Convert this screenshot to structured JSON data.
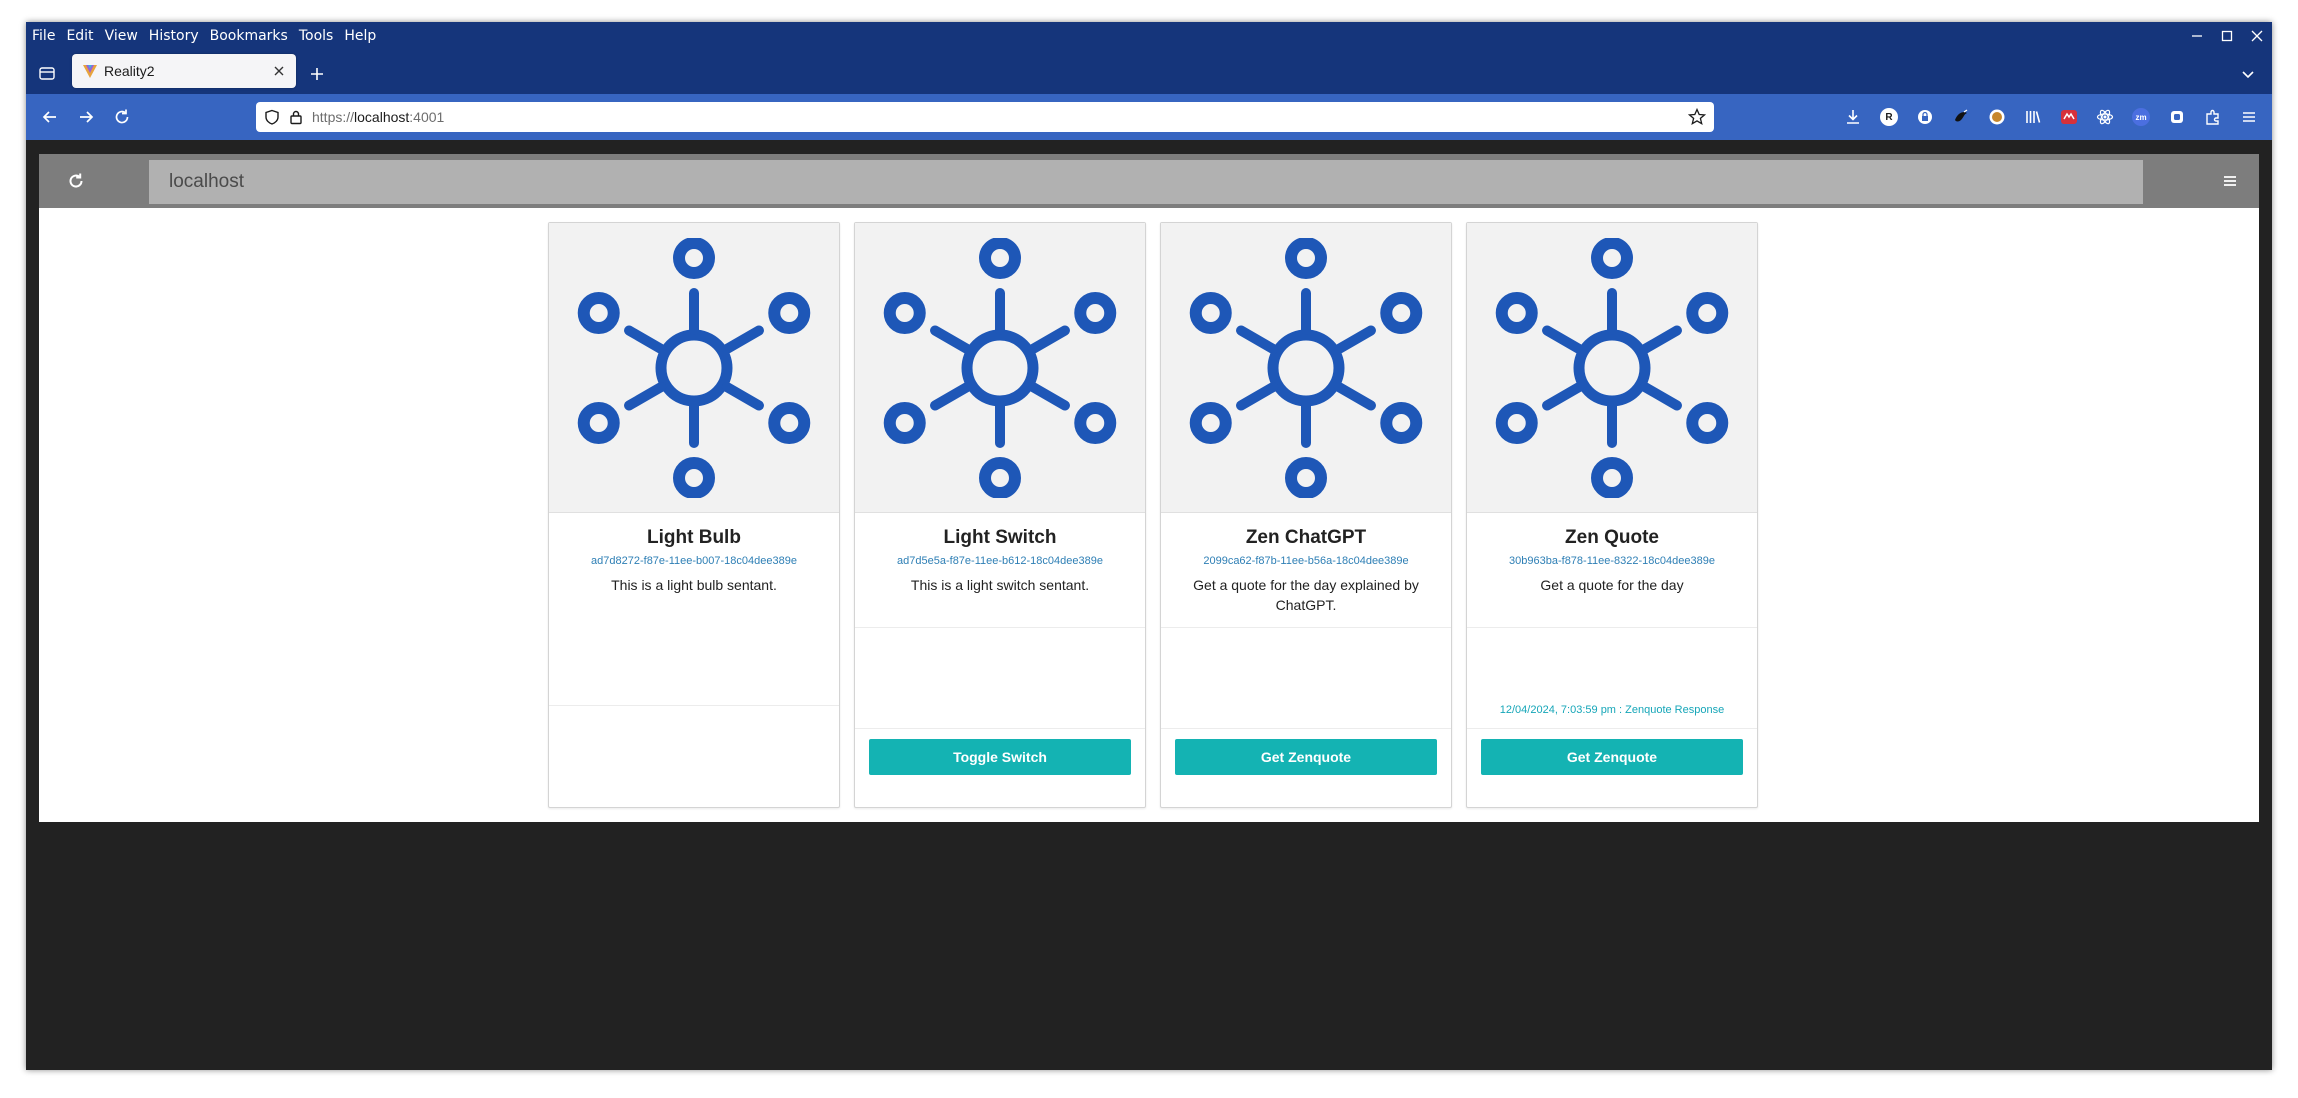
{
  "browser": {
    "menu": [
      "File",
      "Edit",
      "View",
      "History",
      "Bookmarks",
      "Tools",
      "Help"
    ],
    "tab": {
      "title": "Reality2",
      "favicon": "reality2-favicon"
    },
    "url": {
      "scheme": "https://",
      "host": "localhost",
      "port": ":4001"
    },
    "extensions": [
      {
        "name": "downloads-icon"
      },
      {
        "name": "extension-r-icon",
        "label": "R"
      },
      {
        "name": "extension-lock-icon"
      },
      {
        "name": "extension-bird-icon"
      },
      {
        "name": "extension-bulb-icon"
      },
      {
        "name": "library-icon"
      },
      {
        "name": "extension-red-icon"
      },
      {
        "name": "react-devtools-icon"
      },
      {
        "name": "extension-zm-icon",
        "label": "zm"
      },
      {
        "name": "extension-square-icon"
      },
      {
        "name": "extensions-puzzle-icon"
      },
      {
        "name": "app-menu-icon"
      }
    ]
  },
  "app": {
    "search_text": "localhost",
    "accent_color": "#14b3b3",
    "icon_color": "#1e57b7"
  },
  "cards": [
    {
      "title": "Light Bulb",
      "id": "ad7d8272-f87e-11ee-b007-18c04dee389e",
      "description": "This is a light bulb sentant.",
      "status": "",
      "button": ""
    },
    {
      "title": "Light Switch",
      "id": "ad7d5e5a-f87e-11ee-b612-18c04dee389e",
      "description": "This is a light switch sentant.",
      "status": "",
      "button": "Toggle Switch"
    },
    {
      "title": "Zen ChatGPT",
      "id": "2099ca62-f87b-11ee-b56a-18c04dee389e",
      "description": "Get a quote for the day explained by ChatGPT.",
      "status": "",
      "button": "Get Zenquote"
    },
    {
      "title": "Zen Quote",
      "id": "30b963ba-f878-11ee-8322-18c04dee389e",
      "description": "Get a quote for the day",
      "status": "12/04/2024, 7:03:59 pm : Zenquote Response",
      "button": "Get Zenquote"
    }
  ]
}
